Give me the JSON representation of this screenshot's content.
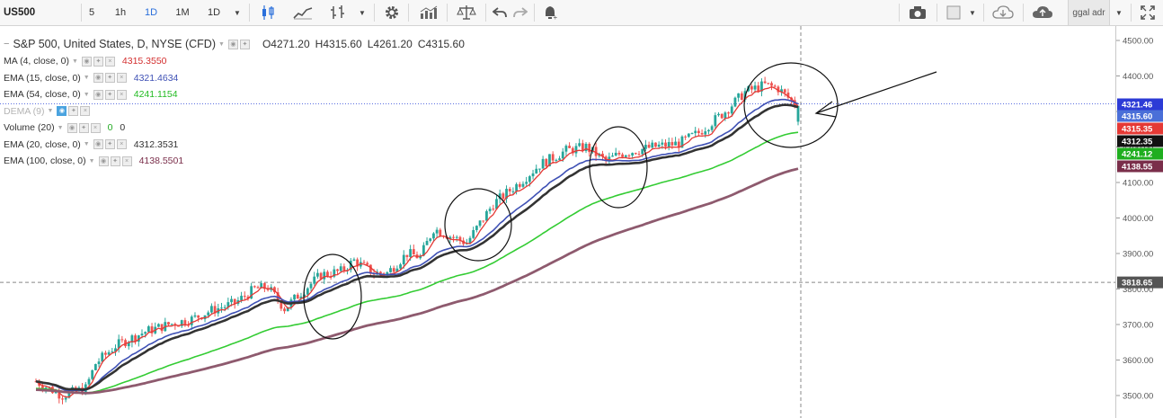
{
  "toolbar": {
    "symbol": "US500",
    "intervals": [
      "5",
      "1h",
      "1D",
      "1M",
      "1D"
    ],
    "active_interval": 2,
    "user": "ggal adr",
    "icons": [
      "candles-icon",
      "line-chart-icon",
      "indicators-icon",
      "settings-icon",
      "bars-icon",
      "scale-icon",
      "undo-icon",
      "redo-icon",
      "alert-icon",
      "camera-icon",
      "layout-icon",
      "cloud-download-icon",
      "cloud-upload-icon",
      "fullscreen-icon"
    ]
  },
  "legend": {
    "main_title": "S&P 500, United States, D, NYSE (CFD)",
    "ohlc": [
      {
        "key": "O",
        "value": "4271.20"
      },
      {
        "key": "H",
        "value": "4315.60"
      },
      {
        "key": "L",
        "value": "4261.20"
      },
      {
        "key": "C",
        "value": "4315.60"
      }
    ],
    "indicators": [
      {
        "label": "MA (4, close, 0)",
        "values": [
          "4315.3550"
        ],
        "colors": [
          "#d32f2f"
        ],
        "dim": false
      },
      {
        "label": "EMA (15, close, 0)",
        "values": [
          "4321.4634"
        ],
        "colors": [
          "#3f51b5"
        ],
        "dim": false
      },
      {
        "label": "EMA (54, close, 0)",
        "values": [
          "4241.1154"
        ],
        "colors": [
          "#22bb22"
        ],
        "dim": false
      },
      {
        "label": "DEMA (9)",
        "values": [],
        "colors": [],
        "dim": true
      },
      {
        "label": "Volume (20)",
        "values": [
          "0",
          "0"
        ],
        "colors": [
          "#22aa22",
          "#333333"
        ],
        "dim": false
      },
      {
        "label": "EMA (20, close, 0)",
        "values": [
          "4312.3531"
        ],
        "colors": [
          "#333333"
        ],
        "dim": false
      },
      {
        "label": "EMA (100, close, 0)",
        "values": [
          "4138.5501"
        ],
        "colors": [
          "#7a2e4a"
        ],
        "dim": false
      }
    ]
  },
  "price_axis": {
    "ticks": [
      "4500.00",
      "4400.00",
      "4300.00",
      "4200.00",
      "4100.00",
      "4000.00",
      "3900.00",
      "3800.00",
      "3700.00",
      "3600.00",
      "3500.00"
    ],
    "tags": [
      {
        "value": "4321.46",
        "bg": "#2c3bd6",
        "fg": "#ffffff"
      },
      {
        "value": "4315.60",
        "bg": "#4a6fd8",
        "fg": "#ffffff"
      },
      {
        "value": "4315.35",
        "bg": "#e53935",
        "fg": "#ffffff"
      },
      {
        "value": "4312.35",
        "bg": "#111111",
        "fg": "#ffffff"
      },
      {
        "value": "4241.12",
        "bg": "#1fae1f",
        "fg": "#ffffff"
      },
      {
        "value": "4138.55",
        "bg": "#7a2e4a",
        "fg": "#ffffff"
      },
      {
        "value": "3818.65",
        "bg": "#555555",
        "fg": "#ffffff"
      }
    ]
  },
  "chart_data": {
    "type": "line",
    "ylim": [
      3470,
      4525
    ],
    "y_ticks": [
      3500,
      3600,
      3700,
      3800,
      3900,
      4000,
      4100,
      4200,
      4300,
      4400,
      4500
    ],
    "grid": false,
    "crosshair_price": 3818.65,
    "series": [
      {
        "name": "MA (4, close, 0)",
        "color": "#e53935",
        "last": 4315.355
      },
      {
        "name": "EMA (15, close, 0)",
        "color": "#3f51b5",
        "last": 4321.4634
      },
      {
        "name": "EMA (54, close, 0)",
        "color": "#33cc33",
        "last": 4241.1154
      },
      {
        "name": "EMA (20, close, 0)",
        "color": "#333333",
        "last": 4312.3531
      },
      {
        "name": "EMA (100, close, 0)",
        "color": "#8e5a6e",
        "last": 4138.5501
      }
    ],
    "candles_count": 170,
    "up_color": "#26a69a",
    "down_color": "#ef5350"
  }
}
